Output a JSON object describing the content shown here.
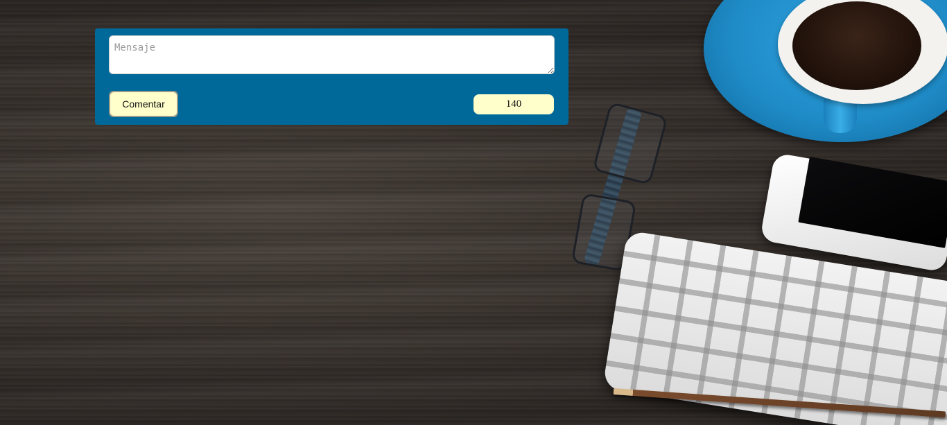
{
  "comment_form": {
    "message_placeholder": "Mensaje",
    "message_value": "",
    "submit_label": "Comentar",
    "char_counter": "140"
  },
  "colors": {
    "panel_background": "#00699a",
    "button_background": "#ffffcc",
    "counter_background": "#ffffcc"
  },
  "background": {
    "decor_items": [
      "coffee-cup-icon",
      "glasses-icon",
      "smartphone-icon",
      "keyboard-icon",
      "pencil-icon"
    ]
  }
}
